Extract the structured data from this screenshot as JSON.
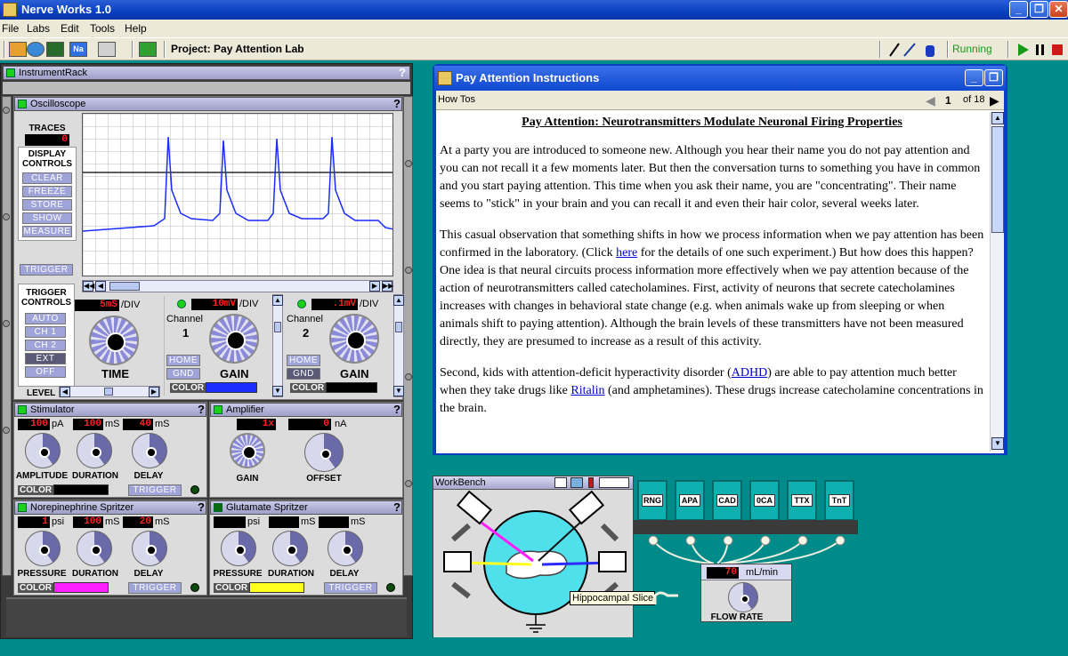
{
  "window": {
    "title": "Nerve Works 1.0",
    "min": "_",
    "max": "❐",
    "close": "✕"
  },
  "menu": [
    "File",
    "Labs",
    "Edit",
    "Tools",
    "Help"
  ],
  "toolbar": {
    "project": "Project: Pay Attention Lab",
    "status": "Running"
  },
  "rack": {
    "title": "InstrumentRack",
    "help": "?",
    "osc": {
      "title": "Oscilloscope",
      "traces_label": "TRACES",
      "traces_value": "0",
      "display_label": "DISPLAY CONTROLS",
      "display_buttons": [
        "CLEAR",
        "FREEZE",
        "STORE",
        "SHOW ALL",
        "MEASURE"
      ],
      "trigger": "TRIGGER",
      "trigger_controls": "TRIGGER CONTROLS",
      "trigger_buttons": [
        "AUTO",
        "CH 1",
        "CH 2",
        "EXT",
        "OFF"
      ],
      "level": "LEVEL",
      "time_value": "5mS",
      "per_div": "/DIV",
      "time_label": "TIME",
      "ch1": {
        "value": "10mV",
        "per_div": "/DIV",
        "channel": "Channel",
        "num": "1",
        "home": "HOME",
        "gnd": "GND",
        "gain": "GAIN",
        "color": "COLOR",
        "swatch": "#1a2cff"
      },
      "ch2": {
        "value": ".1mV",
        "per_div": "/DIV",
        "channel": "Channel",
        "num": "2",
        "home": "HOME",
        "gnd": "GND",
        "gain": "GAIN",
        "color": "COLOR",
        "swatch": "#000000"
      }
    },
    "stim": {
      "title": "Stimulator",
      "v1": "100",
      "u1": "pA",
      "v2": "100",
      "u2": "mS",
      "v3": "40",
      "u3": "mS",
      "k1": "AMPLITUDE",
      "k2": "DURATION",
      "k3": "DELAY",
      "color": "COLOR",
      "swatch": "#000000",
      "trigger": "TRIGGER"
    },
    "amp": {
      "title": "Amplifier",
      "v1": "1x",
      "v2": "0",
      "u2": "nA",
      "k1": "GAIN",
      "k2": "OFFSET"
    },
    "ne": {
      "title": "Norepinephrine Spritzer",
      "v1": "1",
      "u1": "psi",
      "v2": "100",
      "u2": "mS",
      "v3": "20",
      "u3": "mS",
      "k1": "PRESSURE",
      "k2": "DURATION",
      "k3": "DELAY",
      "color": "COLOR",
      "swatch": "#ff20ff",
      "trigger": "TRIGGER"
    },
    "glu": {
      "title": "Glutamate Spritzer",
      "v1": "",
      "u1": "psi",
      "v2": "",
      "u2": "mS",
      "v3": "",
      "u3": "mS",
      "k1": "PRESSURE",
      "k2": "DURATION",
      "k3": "DELAY",
      "color": "COLOR",
      "swatch": "#ffff20",
      "trigger": "TRIGGER"
    }
  },
  "instructions": {
    "title": "Pay Attention Instructions",
    "howtos": "How Tos",
    "page": "1",
    "of": "of 18",
    "heading": "Pay Attention: Neurotransmitters Modulate Neuronal Firing Properties",
    "p1": "At a party you are introduced to someone new. Although you hear their name you do not pay attention and you can not recall it a few moments later. But then the conversation turns to something you have in common and you start paying attention. This time when you ask their name, you are \"concentrating\". Their name seems to \"stick\" in your brain and you can recall it and even their hair color, several weeks later.",
    "p2a": "This casual observation that something shifts in how we process information when we pay attention has been confirmed in the laboratory. (Click ",
    "p2link": "here",
    "p2b": " for the details of one such experiment.) But how does this happen? One idea is that neural circuits process information more effectively when we pay attention because of the action of neurotransmitters called catecholamines. First, activity of neurons that secrete catecholamines increases with changes in behavioral state change (e.g. when animals wake up from sleeping or when animals shift to paying attention). Although the brain levels of these transmitters have not been measured directly, they are presumed to increase as a result of this activity.",
    "p3a": "Second, kids with attention-deficit hyperactivity disorder (",
    "p3link1": "ADHD",
    "p3b": ") are able to pay attention much better when they take drugs like ",
    "p3link2": "Ritalin",
    "p3c": " (and amphetamines).  These drugs increase catecholamine concentrations in the brain."
  },
  "workbench": {
    "title": "WorkBench",
    "tooltip": "Hippocampal Slice"
  },
  "bottles": [
    "RNG",
    "APA",
    "CAD",
    "0CA",
    "TTX",
    "TnT"
  ],
  "flow": {
    "value": "70",
    "unit": "mL/min",
    "label": "FLOW RATE"
  }
}
